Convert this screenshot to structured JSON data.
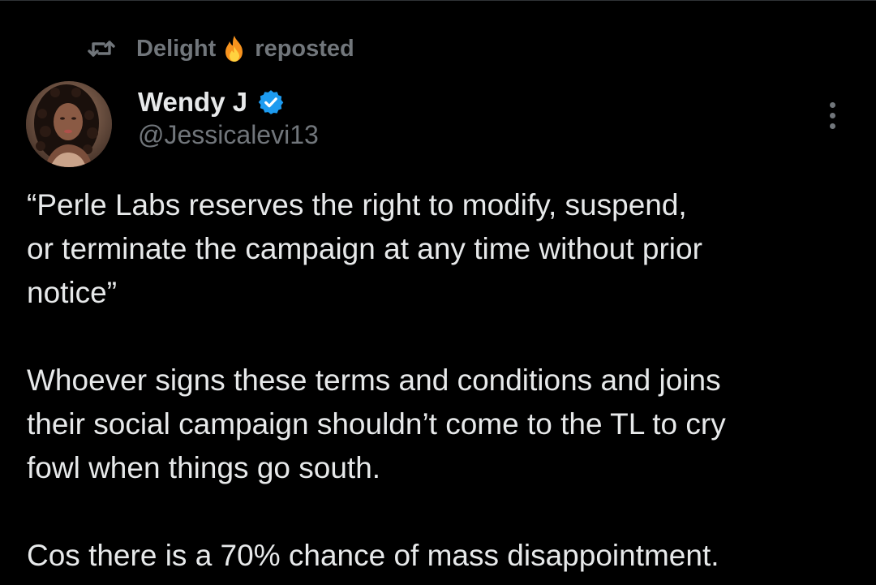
{
  "repost": {
    "user": "Delight",
    "label": "reposted"
  },
  "author": {
    "name": "Wendy J",
    "handle": "@Jessicalevi13"
  },
  "tweet": {
    "paragraphs": [
      "“Perle Labs reserves the right to modify, suspend,\nor terminate the campaign at any time without prior\nnotice”",
      "Whoever signs these terms and conditions and joins\ntheir social campaign shouldn’t come to the TL to cry\nfowl when things go south.",
      "Cos there is a 70% chance of mass disappointment."
    ]
  },
  "icons": {
    "repost": "repost-icon",
    "flame": "fire-emoji",
    "verified": "verified-badge-icon",
    "more": "more-options-icon"
  },
  "colors": {
    "background": "#000000",
    "text_primary": "#e7e9ea",
    "text_secondary": "#71767b",
    "verified_blue": "#1d9bf0"
  }
}
